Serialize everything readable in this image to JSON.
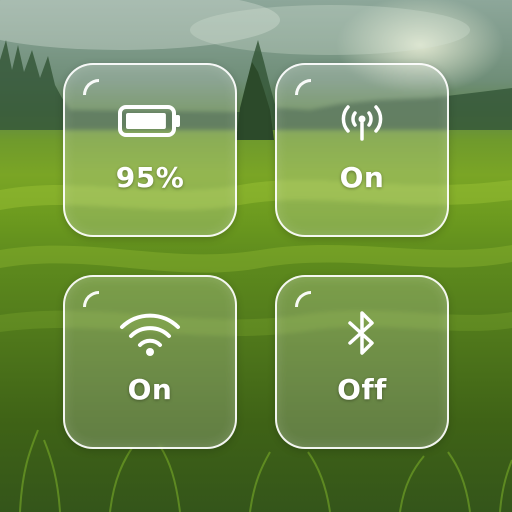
{
  "tiles": {
    "battery": {
      "value": "95%",
      "icon": "battery-icon",
      "level_percent": 95
    },
    "hotspot": {
      "value": "On",
      "icon": "hotspot-icon"
    },
    "wifi": {
      "value": "On",
      "icon": "wifi-icon"
    },
    "bluetooth": {
      "value": "Off",
      "icon": "bluetooth-icon"
    }
  },
  "colors": {
    "tile_text": "#ffffff",
    "tile_border": "#ffffff"
  }
}
